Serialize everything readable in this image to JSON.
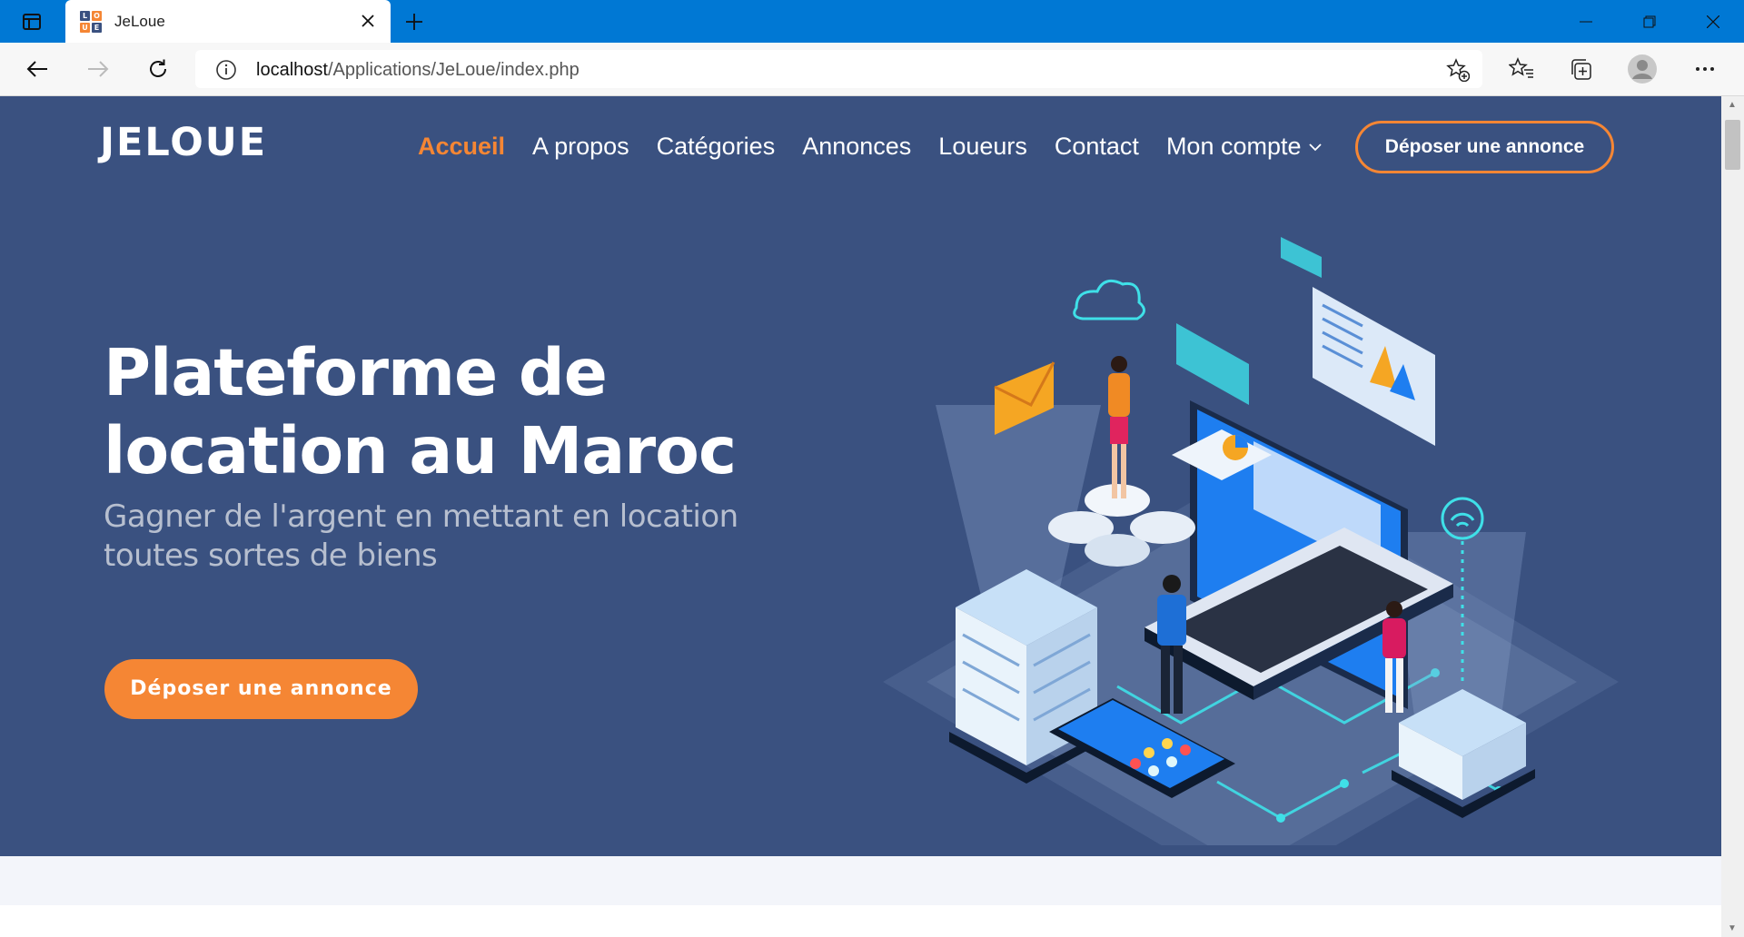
{
  "browser": {
    "tab_title": "JeLoue",
    "favicon_letters": [
      "L",
      "O",
      "U",
      "E"
    ],
    "url_host": "localhost",
    "url_path": "/Applications/JeLoue/index.php",
    "icons": {
      "tab_actions": "tab-actions-icon",
      "close": "close-icon",
      "new_tab": "plus-icon",
      "back": "back-arrow-icon",
      "forward": "forward-arrow-icon",
      "refresh": "refresh-icon",
      "info": "info-icon",
      "add_favorite": "star-plus-icon",
      "favorites": "favorites-icon",
      "collections": "collections-icon",
      "profile": "profile-icon",
      "menu": "more-icon"
    }
  },
  "site": {
    "logo": "JELOUE",
    "nav": [
      {
        "label": "Accueil",
        "active": true
      },
      {
        "label": "A propos"
      },
      {
        "label": "Catégories"
      },
      {
        "label": "Annonces"
      },
      {
        "label": "Loueurs"
      },
      {
        "label": "Contact"
      },
      {
        "label": "Mon compte"
      }
    ],
    "header_cta": "Déposer une annonce"
  },
  "hero": {
    "title": "Plateforme de location au Maroc",
    "subtitle": "Gagner de l'argent en mettant en location toutes sortes de biens",
    "cta": "Déposer une annonce"
  },
  "colors": {
    "chrome_blue": "#0078d4",
    "hero_bg": "#3a5180",
    "accent_orange": "#f58634"
  }
}
